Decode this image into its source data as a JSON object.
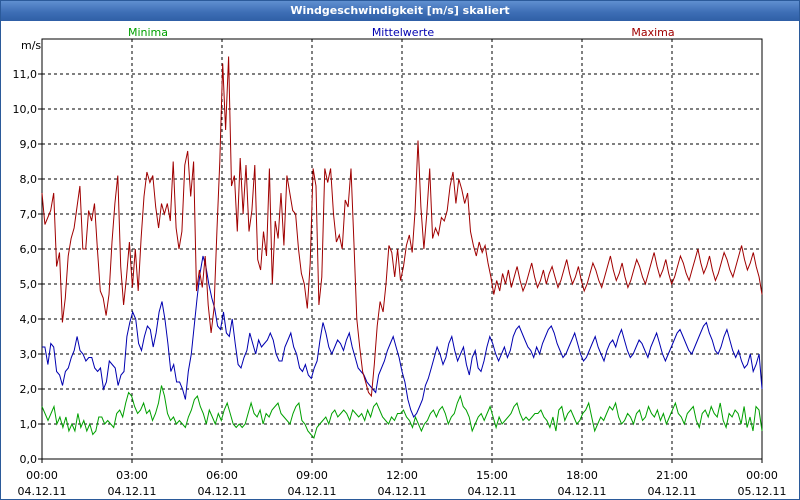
{
  "window": {
    "title": "Windgeschwindigkeit [m/s] skaliert"
  },
  "chart_data": {
    "type": "line",
    "title": "Windgeschwindigkeit [m/s] skaliert",
    "ylabel": "m/s",
    "ylim": [
      0,
      12
    ],
    "y_ticks": [
      "0,0",
      "1,0",
      "2,0",
      "3,0",
      "4,0",
      "5,0",
      "6,0",
      "7,0",
      "8,0",
      "9,0",
      "10,0",
      "11,0"
    ],
    "x_ticks": [
      {
        "time": "00:00",
        "date": "04.12.11"
      },
      {
        "time": "03:00",
        "date": "04.12.11"
      },
      {
        "time": "06:00",
        "date": "04.12.11"
      },
      {
        "time": "09:00",
        "date": "04.12.11"
      },
      {
        "time": "12:00",
        "date": "04.12.11"
      },
      {
        "time": "15:00",
        "date": "04.12.11"
      },
      {
        "time": "18:00",
        "date": "04.12.11"
      },
      {
        "time": "21:00",
        "date": "04.12.11"
      },
      {
        "time": "00:00",
        "date": "05.12.11"
      }
    ],
    "x_range_hours": [
      0,
      24
    ],
    "x_step_hours": 0.5,
    "grid": true,
    "legend_position": "top",
    "series": [
      {
        "name": "Minima",
        "color": "#00a000",
        "values": [
          1.5,
          1.3,
          1.1,
          1.3,
          1.5,
          1.0,
          1.2,
          0.9,
          1.2,
          0.8,
          1.0,
          0.8,
          1.3,
          0.9,
          1.1,
          0.8,
          1.0,
          0.7,
          0.8,
          1.2,
          1.2,
          1.0,
          1.1,
          1.0,
          0.9,
          1.3,
          1.4,
          1.2,
          1.6,
          1.9,
          1.8,
          1.5,
          1.3,
          1.4,
          1.6,
          1.3,
          1.4,
          1.1,
          1.3,
          1.6,
          2.1,
          1.8,
          1.3,
          1.1,
          1.2,
          1.0,
          1.1,
          1.0,
          0.9,
          1.2,
          1.4,
          1.7,
          1.8,
          1.5,
          1.3,
          1.0,
          1.4,
          1.2,
          1.0,
          1.3,
          1.1,
          1.4,
          1.6,
          1.3,
          1.0,
          0.9,
          1.0,
          0.9,
          1.0,
          1.3,
          1.6,
          1.3,
          1.2,
          1.4,
          1.0,
          1.3,
          1.2,
          1.4,
          1.5,
          1.6,
          1.3,
          1.2,
          1.1,
          1.0,
          1.3,
          1.5,
          1.6,
          1.1,
          1.0,
          0.8,
          0.7,
          0.6,
          0.9,
          1.0,
          1.1,
          1.2,
          1.0,
          1.3,
          1.4,
          1.2,
          1.3,
          1.4,
          1.3,
          1.1,
          1.4,
          1.3,
          1.2,
          1.3,
          1.1,
          1.4,
          1.2,
          1.5,
          1.6,
          1.4,
          1.2,
          1.1,
          1.0,
          1.2,
          1.1,
          1.3,
          1.3,
          1.4,
          1.2,
          1.1,
          0.9,
          1.2,
          1.0,
          0.8,
          1.0,
          1.1,
          1.3,
          1.4,
          1.2,
          1.4,
          1.5,
          1.3,
          1.0,
          1.2,
          1.3,
          1.6,
          1.8,
          1.5,
          1.4,
          1.2,
          0.8,
          1.0,
          1.2,
          1.3,
          1.1,
          1.3,
          1.5,
          1.2,
          0.9,
          1.2,
          1.0,
          1.1,
          1.2,
          1.3,
          1.5,
          1.6,
          1.3,
          1.1,
          1.2,
          1.1,
          1.2,
          1.3,
          1.3,
          1.4,
          1.2,
          1.1,
          0.9,
          1.2,
          0.8,
          1.4,
          1.5,
          1.1,
          1.3,
          1.4,
          1.2,
          1.0,
          1.1,
          1.3,
          1.4,
          1.6,
          1.2,
          0.8,
          1.0,
          1.2,
          1.1,
          1.3,
          1.5,
          1.4,
          1.6,
          1.2,
          1.0,
          1.1,
          1.3,
          1.2,
          1.0,
          1.3,
          1.4,
          1.1,
          1.2,
          1.5,
          1.3,
          1.2,
          1.4,
          1.1,
          1.3,
          1.0,
          1.2,
          1.4,
          1.6,
          1.3,
          1.2,
          1.0,
          1.3,
          1.4,
          1.5,
          1.1,
          0.9,
          1.3,
          1.4,
          1.2,
          1.5,
          1.3,
          1.2,
          1.6,
          1.1,
          0.9,
          1.3,
          1.2,
          1.4,
          1.3,
          1.0,
          1.5,
          0.9,
          1.2,
          0.8,
          1.5,
          1.4,
          0.8
        ]
      },
      {
        "name": "Mittelwerte",
        "color": "#0000b0",
        "values": [
          3.2,
          3.2,
          2.7,
          3.3,
          3.2,
          2.5,
          2.4,
          2.1,
          2.5,
          2.6,
          2.9,
          3.1,
          3.5,
          3.1,
          3.0,
          2.8,
          2.9,
          2.9,
          2.6,
          2.5,
          2.6,
          2.0,
          2.2,
          2.8,
          2.7,
          2.6,
          2.1,
          2.4,
          2.5,
          3.5,
          3.9,
          4.2,
          4.0,
          3.3,
          3.1,
          3.5,
          3.8,
          3.7,
          3.2,
          3.6,
          4.2,
          4.5,
          4.0,
          3.3,
          2.5,
          2.7,
          2.2,
          2.2,
          2.0,
          1.7,
          2.5,
          3.0,
          3.8,
          4.6,
          5.3,
          5.8,
          5.5,
          5.0,
          4.6,
          4.3,
          3.8,
          3.7,
          4.2,
          3.6,
          3.5,
          4.0,
          3.3,
          2.7,
          2.6,
          2.9,
          3.1,
          3.6,
          3.3,
          3.0,
          3.4,
          3.2,
          3.3,
          3.4,
          3.6,
          3.4,
          3.0,
          2.8,
          2.8,
          3.2,
          3.4,
          3.6,
          3.2,
          3.0,
          2.6,
          2.5,
          2.7,
          2.4,
          2.3,
          2.6,
          2.8,
          3.4,
          3.9,
          3.6,
          3.2,
          3.0,
          3.2,
          3.4,
          3.3,
          3.1,
          3.4,
          3.6,
          3.2,
          2.9,
          2.6,
          2.5,
          2.4,
          2.2,
          2.1,
          2.0,
          1.9,
          2.4,
          2.6,
          2.8,
          3.1,
          3.3,
          3.5,
          3.2,
          2.9,
          2.5,
          2.2,
          1.7,
          1.4,
          1.2,
          1.3,
          1.5,
          1.7,
          2.1,
          2.3,
          2.6,
          2.9,
          3.2,
          3.0,
          2.7,
          2.9,
          3.3,
          3.5,
          3.1,
          2.8,
          3.0,
          3.2,
          2.7,
          2.4,
          2.9,
          3.1,
          2.6,
          2.5,
          2.8,
          3.2,
          3.5,
          3.3,
          3.0,
          2.8,
          3.0,
          3.2,
          2.9,
          3.1,
          3.5,
          3.7,
          3.8,
          3.6,
          3.4,
          3.2,
          3.1,
          2.9,
          3.2,
          3.0,
          3.3,
          3.5,
          3.7,
          3.8,
          3.6,
          3.3,
          3.1,
          2.9,
          3.0,
          3.2,
          3.4,
          3.6,
          3.3,
          3.0,
          2.8,
          2.9,
          3.1,
          3.3,
          3.5,
          3.2,
          3.0,
          2.8,
          3.1,
          3.3,
          3.4,
          3.2,
          3.5,
          3.7,
          3.4,
          3.1,
          2.9,
          3.0,
          3.2,
          3.4,
          3.3,
          3.1,
          2.9,
          3.2,
          3.4,
          3.6,
          3.3,
          3.0,
          2.8,
          3.0,
          3.2,
          3.4,
          3.6,
          3.7,
          3.5,
          3.3,
          3.1,
          3.0,
          3.2,
          3.4,
          3.6,
          3.8,
          3.9,
          3.6,
          3.4,
          3.1,
          3.0,
          3.2,
          3.5,
          3.7,
          3.4,
          3.1,
          2.9,
          3.1,
          2.8,
          2.6,
          2.7,
          3.0,
          2.5,
          2.7,
          3.0,
          2.0
        ]
      },
      {
        "name": "Maxima",
        "color": "#a00000",
        "values": [
          7.6,
          6.7,
          6.9,
          7.1,
          7.6,
          5.5,
          5.9,
          3.9,
          4.6,
          5.8,
          6.3,
          6.6,
          7.2,
          7.8,
          6.0,
          6.0,
          7.1,
          6.8,
          7.3,
          6.0,
          4.8,
          4.6,
          4.1,
          4.7,
          6.2,
          7.3,
          8.1,
          5.5,
          4.4,
          5.2,
          6.2,
          4.9,
          6.0,
          4.8,
          6.3,
          7.5,
          8.2,
          7.9,
          8.1,
          7.2,
          6.6,
          7.3,
          7.0,
          7.3,
          6.8,
          8.5,
          6.6,
          6.0,
          6.5,
          8.4,
          8.8,
          7.5,
          8.5,
          4.8,
          5.4,
          4.9,
          5.8,
          4.4,
          3.6,
          4.3,
          6.5,
          8.5,
          11.3,
          9.4,
          11.5,
          7.8,
          8.1,
          6.5,
          8.6,
          7.0,
          8.4,
          6.5,
          7.1,
          8.4,
          5.7,
          5.4,
          6.5,
          5.8,
          8.3,
          5.0,
          6.8,
          6.3,
          7.6,
          6.1,
          8.1,
          7.6,
          7.1,
          7.0,
          6.0,
          5.3,
          5.0,
          4.3,
          5.6,
          8.3,
          7.8,
          4.4,
          5.2,
          8.3,
          7.9,
          8.3,
          7.0,
          6.2,
          6.4,
          6.0,
          7.4,
          7.2,
          8.3,
          6.2,
          4.0,
          3.2,
          2.5,
          2.2,
          1.9,
          1.8,
          2.7,
          3.8,
          4.5,
          4.2,
          5.0,
          6.1,
          5.9,
          5.2,
          6.0,
          5.1,
          5.5,
          6.1,
          6.4,
          5.9,
          7.1,
          9.1,
          7.2,
          6.0,
          7.0,
          8.3,
          6.3,
          6.6,
          6.4,
          6.9,
          6.8,
          7.1,
          7.8,
          8.2,
          7.3,
          8.0,
          7.7,
          7.3,
          7.6,
          6.5,
          6.1,
          5.8,
          6.2,
          5.9,
          6.1,
          5.6,
          5.2,
          4.7,
          5.1,
          4.8,
          5.3,
          5.0,
          5.4,
          4.9,
          5.2,
          5.5,
          5.1,
          4.8,
          5.0,
          5.3,
          5.6,
          5.2,
          4.9,
          5.1,
          5.4,
          5.0,
          5.3,
          5.5,
          5.2,
          4.9,
          5.1,
          5.4,
          5.7,
          5.3,
          5.0,
          5.2,
          5.5,
          5.1,
          4.8,
          5.0,
          5.3,
          5.6,
          5.4,
          5.1,
          4.9,
          5.2,
          5.5,
          5.8,
          5.4,
          5.1,
          5.3,
          5.6,
          5.2,
          4.9,
          5.1,
          5.4,
          5.7,
          5.5,
          5.2,
          5.0,
          5.3,
          5.6,
          5.9,
          5.5,
          5.2,
          5.4,
          5.7,
          5.3,
          5.0,
          5.2,
          5.5,
          5.8,
          5.6,
          5.3,
          5.1,
          5.4,
          5.7,
          6.0,
          5.6,
          5.3,
          5.5,
          5.8,
          5.4,
          5.1,
          5.3,
          5.6,
          5.9,
          5.7,
          5.4,
          5.2,
          5.5,
          5.8,
          6.1,
          5.7,
          5.4,
          5.6,
          5.9,
          5.5,
          5.2,
          4.7
        ]
      }
    ]
  }
}
